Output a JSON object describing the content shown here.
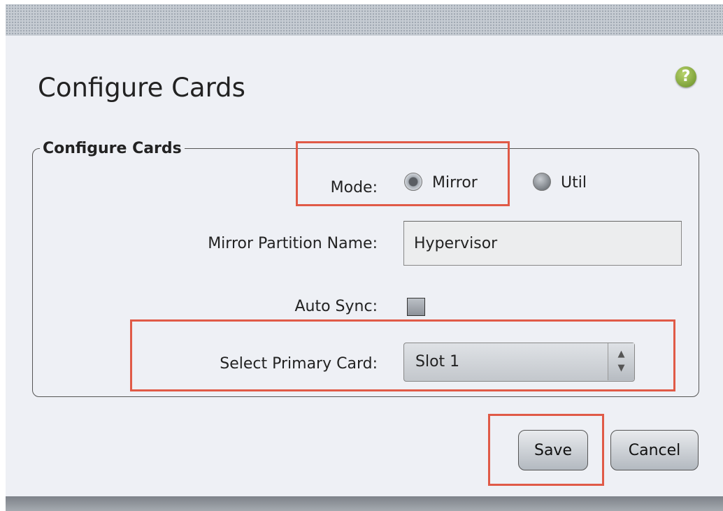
{
  "dialog": {
    "title": "Configure Cards",
    "help_icon": "help-icon",
    "help_glyph": "?"
  },
  "group": {
    "legend": "Configure Cards",
    "mode": {
      "label": "Mode:",
      "options": [
        {
          "label": "Mirror",
          "selected": true
        },
        {
          "label": "Util",
          "selected": false
        }
      ]
    },
    "mirror_partition": {
      "label": "Mirror Partition Name:",
      "value": "Hypervisor"
    },
    "auto_sync": {
      "label": "Auto Sync:",
      "checked": false
    },
    "primary_card": {
      "label": "Select Primary Card:",
      "selected": "Slot 1"
    }
  },
  "buttons": {
    "save": "Save",
    "cancel": "Cancel"
  },
  "colors": {
    "highlight": "#e05a47",
    "background": "#eef0f5"
  }
}
